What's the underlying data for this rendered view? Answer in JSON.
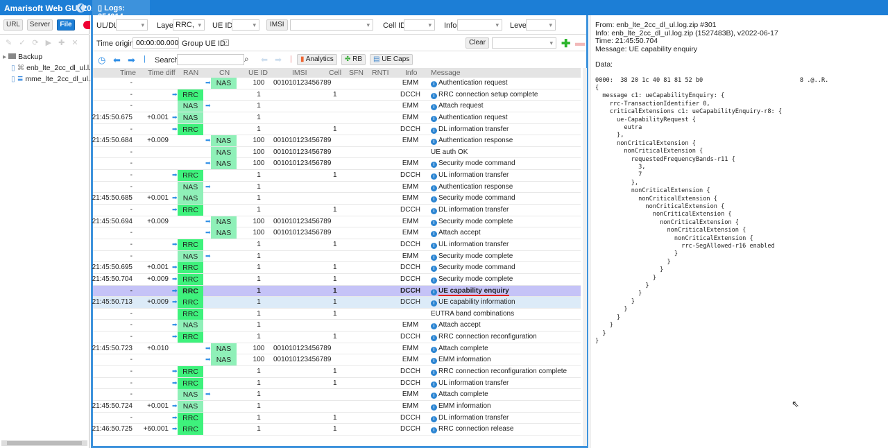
{
  "app": {
    "title": "Amarisoft Web GUI 20...",
    "tab": "Logs: 254014"
  },
  "left": {
    "buttons": [
      "URL",
      "Server",
      "File"
    ],
    "tree": [
      "Backup",
      "enb_lte_2cc_dl_ul.l...",
      "mme_lte_2cc_dl_ul...."
    ]
  },
  "filters": {
    "uldl_label": "UL/DL",
    "uldl_value": "",
    "layer_label": "Layer",
    "layer_value": "RRC,",
    "ueid_label": "UE ID",
    "ueid_value": "",
    "imsi_button": "IMSI",
    "imsi_value": "",
    "cellid_label": "Cell ID",
    "info_label": "Info",
    "level_label": "Level",
    "time_origin_label": "Time origin:",
    "time_origin_value": "00:00:00.000",
    "group_ueid_label": "Group UE ID:",
    "clear_button": "Clear"
  },
  "toolbar": {
    "search_label": "Search",
    "search_value": "",
    "analytics": "Analytics",
    "rb": "RB",
    "uecaps": "UE Caps"
  },
  "columns": [
    "Time",
    "Time diff",
    "RAN",
    "CN",
    "UE ID",
    "IMSI",
    "Cell",
    "SFN",
    "RNTI",
    "Info",
    "Message"
  ],
  "rows": [
    [
      "-",
      "",
      "",
      "mid",
      "NAS",
      "100",
      "001010123456789",
      "",
      "EMM",
      "Authentication request",
      true
    ],
    [
      "-",
      "",
      "RRC",
      "left",
      "",
      "1",
      "",
      "1",
      "DCCH",
      "RRC connection setup complete",
      true
    ],
    [
      "-",
      "",
      "NAS",
      "mid",
      "",
      "1",
      "",
      "",
      "EMM",
      "Attach request",
      true
    ],
    [
      "21:45:50.675",
      "+0.001",
      "NAS",
      "left",
      "",
      "1",
      "",
      "",
      "EMM",
      "Authentication request",
      true
    ],
    [
      "-",
      "",
      "RRC",
      "left",
      "",
      "1",
      "",
      "1",
      "DCCH",
      "DL information transfer",
      true
    ],
    [
      "21:45:50.684",
      "+0.009",
      "",
      "mid",
      "NAS",
      "100",
      "001010123456789",
      "",
      "EMM",
      "Authentication response",
      true
    ],
    [
      "-",
      "",
      "",
      "",
      "NAS",
      "100",
      "001010123456789",
      "",
      "",
      "UE auth OK",
      false
    ],
    [
      "-",
      "",
      "",
      "mid",
      "NAS",
      "100",
      "001010123456789",
      "",
      "EMM",
      "Security mode command",
      true
    ],
    [
      "-",
      "",
      "RRC",
      "left",
      "",
      "1",
      "",
      "1",
      "DCCH",
      "UL information transfer",
      true
    ],
    [
      "-",
      "",
      "NAS",
      "mid",
      "",
      "1",
      "",
      "",
      "EMM",
      "Authentication response",
      true
    ],
    [
      "21:45:50.685",
      "+0.001",
      "NAS",
      "left",
      "",
      "1",
      "",
      "",
      "EMM",
      "Security mode command",
      true
    ],
    [
      "-",
      "",
      "RRC",
      "left",
      "",
      "1",
      "",
      "1",
      "DCCH",
      "DL information transfer",
      true
    ],
    [
      "21:45:50.694",
      "+0.009",
      "",
      "mid",
      "NAS",
      "100",
      "001010123456789",
      "",
      "EMM",
      "Security mode complete",
      true
    ],
    [
      "-",
      "",
      "",
      "mid",
      "NAS",
      "100",
      "001010123456789",
      "",
      "EMM",
      "Attach accept",
      true
    ],
    [
      "-",
      "",
      "RRC",
      "left",
      "",
      "1",
      "",
      "1",
      "DCCH",
      "UL information transfer",
      true
    ],
    [
      "-",
      "",
      "NAS",
      "mid",
      "",
      "1",
      "",
      "",
      "EMM",
      "Security mode complete",
      true
    ],
    [
      "21:45:50.695",
      "+0.001",
      "RRC",
      "left",
      "",
      "1",
      "",
      "1",
      "DCCH",
      "Security mode command",
      true
    ],
    [
      "21:45:50.704",
      "+0.009",
      "RRC",
      "left",
      "",
      "1",
      "",
      "1",
      "DCCH",
      "Security mode complete",
      true
    ],
    [
      "-",
      "",
      "RRC",
      "left",
      "",
      "1",
      "",
      "1",
      "DCCH",
      "UE capability enquiry",
      true
    ],
    [
      "21:45:50.713",
      "+0.009",
      "RRC",
      "left",
      "",
      "1",
      "",
      "1",
      "DCCH",
      "UE capability information",
      true
    ],
    [
      "-",
      "",
      "RRC",
      "",
      "",
      "1",
      "",
      "1",
      "",
      "EUTRA band combinations",
      false
    ],
    [
      "-",
      "",
      "NAS",
      "left",
      "",
      "1",
      "",
      "",
      "EMM",
      "Attach accept",
      true
    ],
    [
      "-",
      "",
      "RRC",
      "left",
      "",
      "1",
      "",
      "1",
      "DCCH",
      "RRC connection reconfiguration",
      true
    ],
    [
      "21:45:50.723",
      "+0.010",
      "",
      "mid",
      "NAS",
      "100",
      "001010123456789",
      "",
      "EMM",
      "Attach complete",
      true
    ],
    [
      "-",
      "",
      "",
      "mid",
      "NAS",
      "100",
      "001010123456789",
      "",
      "EMM",
      "EMM information",
      true
    ],
    [
      "-",
      "",
      "RRC",
      "left",
      "",
      "1",
      "",
      "1",
      "DCCH",
      "RRC connection reconfiguration complete",
      true
    ],
    [
      "-",
      "",
      "RRC",
      "left",
      "",
      "1",
      "",
      "1",
      "DCCH",
      "UL information transfer",
      true
    ],
    [
      "-",
      "",
      "NAS",
      "mid",
      "",
      "1",
      "",
      "",
      "EMM",
      "Attach complete",
      true
    ],
    [
      "21:45:50.724",
      "+0.001",
      "NAS",
      "left",
      "",
      "1",
      "",
      "",
      "EMM",
      "EMM information",
      true
    ],
    [
      "-",
      "",
      "RRC",
      "left",
      "",
      "1",
      "",
      "1",
      "DCCH",
      "DL information transfer",
      true
    ],
    [
      "21:46:50.725",
      "+60.001",
      "RRC",
      "left",
      "",
      "1",
      "",
      "1",
      "DCCH",
      "RRC connection release",
      true
    ]
  ],
  "selected_row": 18,
  "highlight_row": 19,
  "detail": {
    "from": "From: enb_lte_2cc_dl_ul.log.zip #301",
    "info": "Info: enb_lte_2cc_dl_ul.log.zip (1527483B), v2022-06-17",
    "time": "Time: 21:45:50.704",
    "message": "Message: UE capability enquiry",
    "data_label": "Data:",
    "body": "0000:  38 20 1c 40 81 81 52 b0                           8 .@..R.\n{\n  message c1: ueCapabilityEnquiry: {\n    rrc-TransactionIdentifier 0,\n    criticalExtensions c1: ueCapabilityEnquiry-r8: {\n      ue-CapabilityRequest {\n        eutra\n      },\n      nonCriticalExtension {\n        nonCriticalExtension {\n          requestedFrequencyBands-r11 {\n            3,\n            7\n          },\n          nonCriticalExtension {\n            nonCriticalExtension {\n              nonCriticalExtension {\n                nonCriticalExtension {\n                  nonCriticalExtension {\n                    nonCriticalExtension {\n                      nonCriticalExtension {\n                        rrc-SegAllowed-r16 enabled\n                      }\n                    }\n                  }\n                }\n              }\n            }\n          }\n        }\n      }\n    }\n  }\n}"
  },
  "colors": {
    "accent": "#1c7ed6",
    "rrc": "#3ef27c",
    "nas": "#8ff0b8",
    "selected": "#c5c3f7"
  }
}
